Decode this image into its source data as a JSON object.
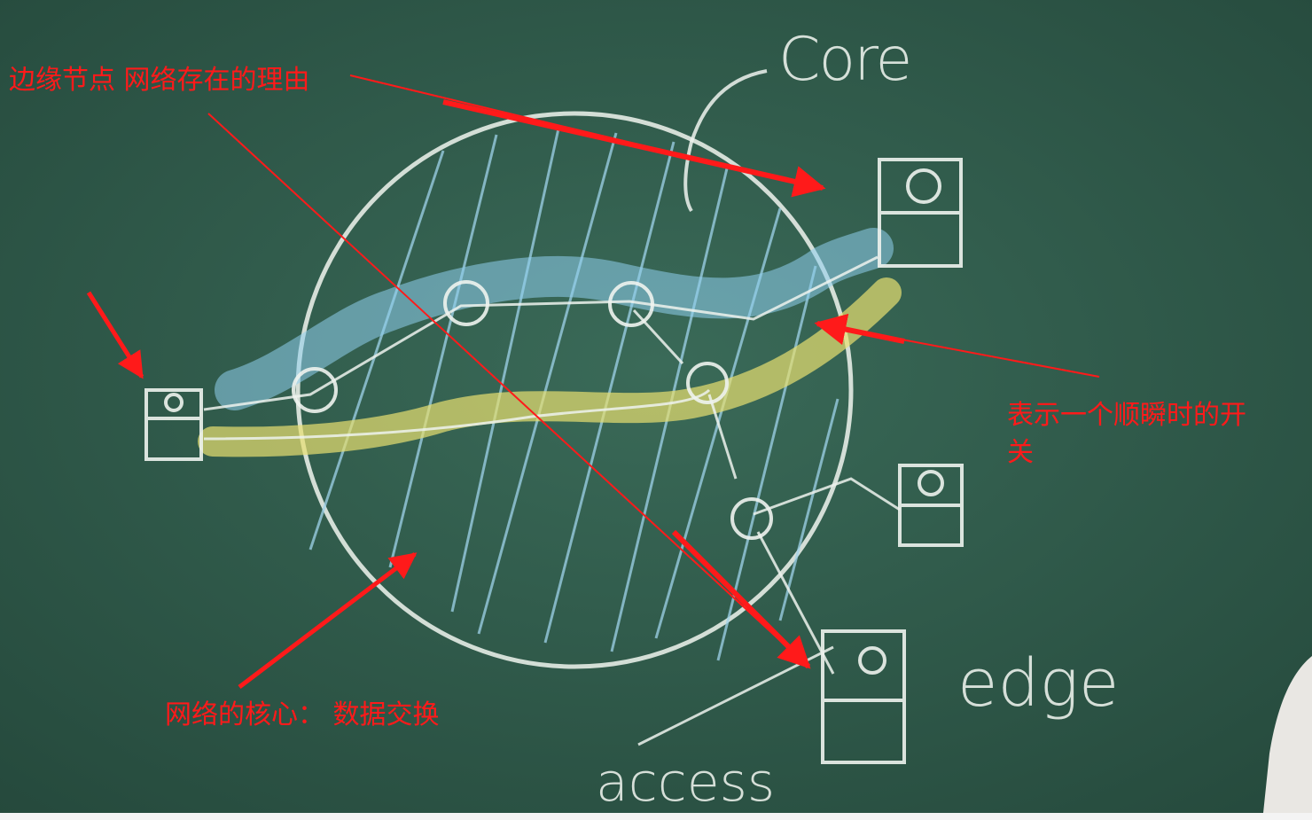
{
  "annotations": {
    "edge_nodes": "边缘节点 网络存在的理由",
    "switch_line1": "表示一个顺瞬时的开",
    "switch_line2": "关",
    "network_core": "网络的核心： 数据交换"
  },
  "chalk_labels": {
    "core": "Core",
    "edge": "edge",
    "access": "access"
  },
  "colors": {
    "board": "#2f5a4a",
    "chalk": "#e9efe9",
    "annotation_red": "#ff1a1a",
    "blue_highlight": "#8fd0ee",
    "yellow_highlight": "#e8e070"
  }
}
